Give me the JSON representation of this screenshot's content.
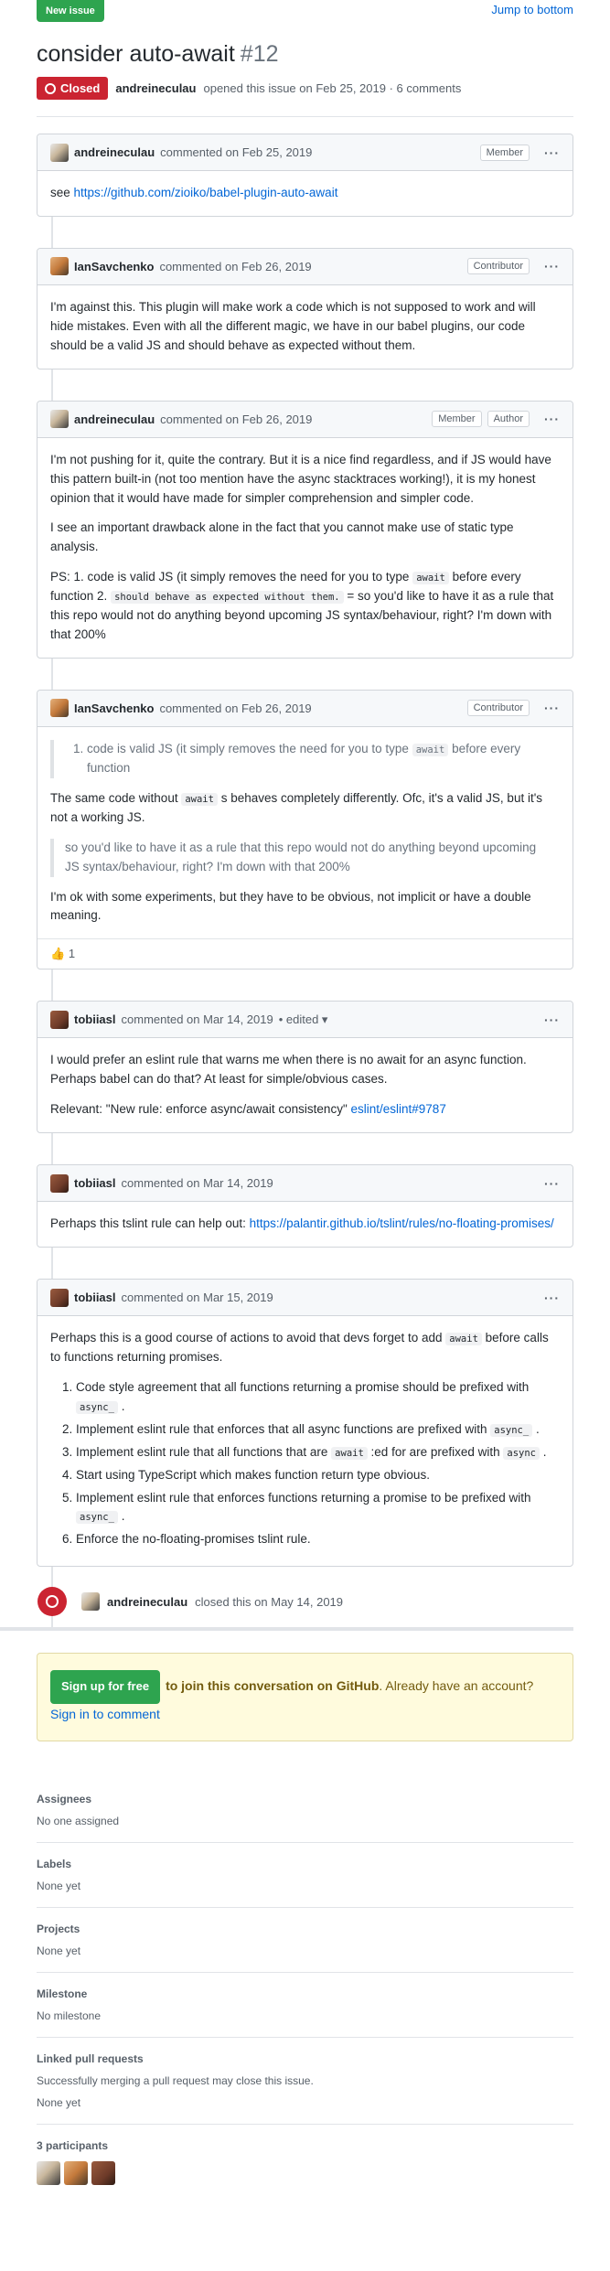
{
  "topbar": {
    "new_issue_label": "New issue",
    "jump_label": "Jump to bottom"
  },
  "issue": {
    "title": "consider auto-await",
    "number": "#12",
    "status": "Closed",
    "author": "andreineculau",
    "opened_text": "opened this issue on Feb 25, 2019 · 6 comments"
  },
  "comments": [
    {
      "user": "andreineculau",
      "date": "commented on Feb 25, 2019",
      "badges": [
        "Member"
      ],
      "link": "https://github.com/zioiko/babel-plugin-auto-await"
    },
    {
      "user": "IanSavchenko",
      "date": "commented on Feb 26, 2019",
      "badges": [
        "Contributor"
      ],
      "text": "I'm against this. This plugin will make work a code which is not supposed to work and will hide mistakes. Even with all the different magic, we have in our babel plugins, our code should be a valid JS and should behave as expected without them."
    },
    {
      "user": "andreineculau",
      "date": "commented on Feb 26, 2019",
      "badges": [
        "Member",
        "Author"
      ],
      "p1": "I'm not pushing for it, quite the contrary. But it is a nice find regardless, and if JS would have this pattern built-in (not too mention have the async stacktraces working!), it is my honest opinion that it would have made for simpler comprehension and simpler code.",
      "p2": "I see an important drawback alone in the fact that you cannot make use of static type analysis.",
      "p3a": "PS: 1. code is valid JS (it simply removes the need for you to type",
      "p3code1": "await",
      "p3b": "before every function 2.",
      "p3code2": "should behave as expected without them.",
      "p3c": "= so you'd like to have it as a rule that this repo would not do anything beyond upcoming JS syntax/behaviour, right? I'm down with that 200%"
    },
    {
      "user": "IanSavchenko",
      "date": "commented on Feb 26, 2019",
      "badges": [
        "Contributor"
      ],
      "quote1a": "code is valid JS (it simply removes the need for you to type",
      "quote1code": "await",
      "quote1b": "before every function",
      "p1a": "The same code without",
      "p1code": "await",
      "p1b": "s behaves completely differently. Ofc, it's a valid JS, but it's not a working JS.",
      "quote2": "so you'd like to have it as a rule that this repo would not do anything beyond upcoming JS syntax/behaviour, right? I'm down with that 200%",
      "p2": "I'm ok with some experiments, but they have to be obvious, not implicit or have a double meaning.",
      "reaction_emoji": "👍",
      "reaction_count": "1"
    },
    {
      "user": "tobiiasl",
      "date": "commented on Mar 14, 2019",
      "edited": "• edited ▾",
      "p1": "I would prefer an eslint rule that warns me when there is no await for an async function. Perhaps babel can do that? At least for simple/obvious cases.",
      "p2": "Relevant: \"New rule: enforce async/await consistency\"",
      "p2link": "eslint/eslint#9787"
    },
    {
      "user": "tobiiasl",
      "date": "commented on Mar 14, 2019",
      "p1": "Perhaps this tslint rule can help out:",
      "p1link": "https://palantir.github.io/tslint/rules/no-floating-promises/"
    },
    {
      "user": "tobiiasl",
      "date": "commented on Mar 15, 2019",
      "intro_a": "Perhaps this is a good course of actions to avoid that devs forget to add",
      "intro_code": "await",
      "intro_b": "before calls to functions returning promises.",
      "items": [
        {
          "a": "Code style agreement that all functions returning a promise should be prefixed with",
          "code": "async_",
          "b": "."
        },
        {
          "a": "Implement eslint rule that enforces that all async functions are prefixed with",
          "code": "async_",
          "b": "."
        },
        {
          "a": "Implement eslint rule that all functions that are",
          "code": "await",
          "b": ":ed for are prefixed with",
          "code2": "async",
          "c": "."
        },
        {
          "a": "Start using TypeScript which makes function return type obvious."
        },
        {
          "a": "Implement eslint rule that enforces functions returning a promise to be prefixed with",
          "code": "async_",
          "b": "."
        },
        {
          "a": "Enforce the no-floating-promises tslint rule."
        }
      ]
    }
  ],
  "closed_event": {
    "user": "andreineculau",
    "text": "closed this on May 14, 2019"
  },
  "signup": {
    "button": "Sign up for free",
    "text": "to join this conversation on GitHub",
    "text2": ". Already have an account?",
    "signin": "Sign in to comment"
  },
  "sidebar": {
    "assignees": {
      "title": "Assignees",
      "value": "No one assigned"
    },
    "labels": {
      "title": "Labels",
      "value": "None yet"
    },
    "projects": {
      "title": "Projects",
      "value": "None yet"
    },
    "milestone": {
      "title": "Milestone",
      "value": "No milestone"
    },
    "linked": {
      "title": "Linked pull requests",
      "note": "Successfully merging a pull request may close this issue.",
      "value": "None yet"
    },
    "participants": {
      "title": "3 participants"
    }
  }
}
